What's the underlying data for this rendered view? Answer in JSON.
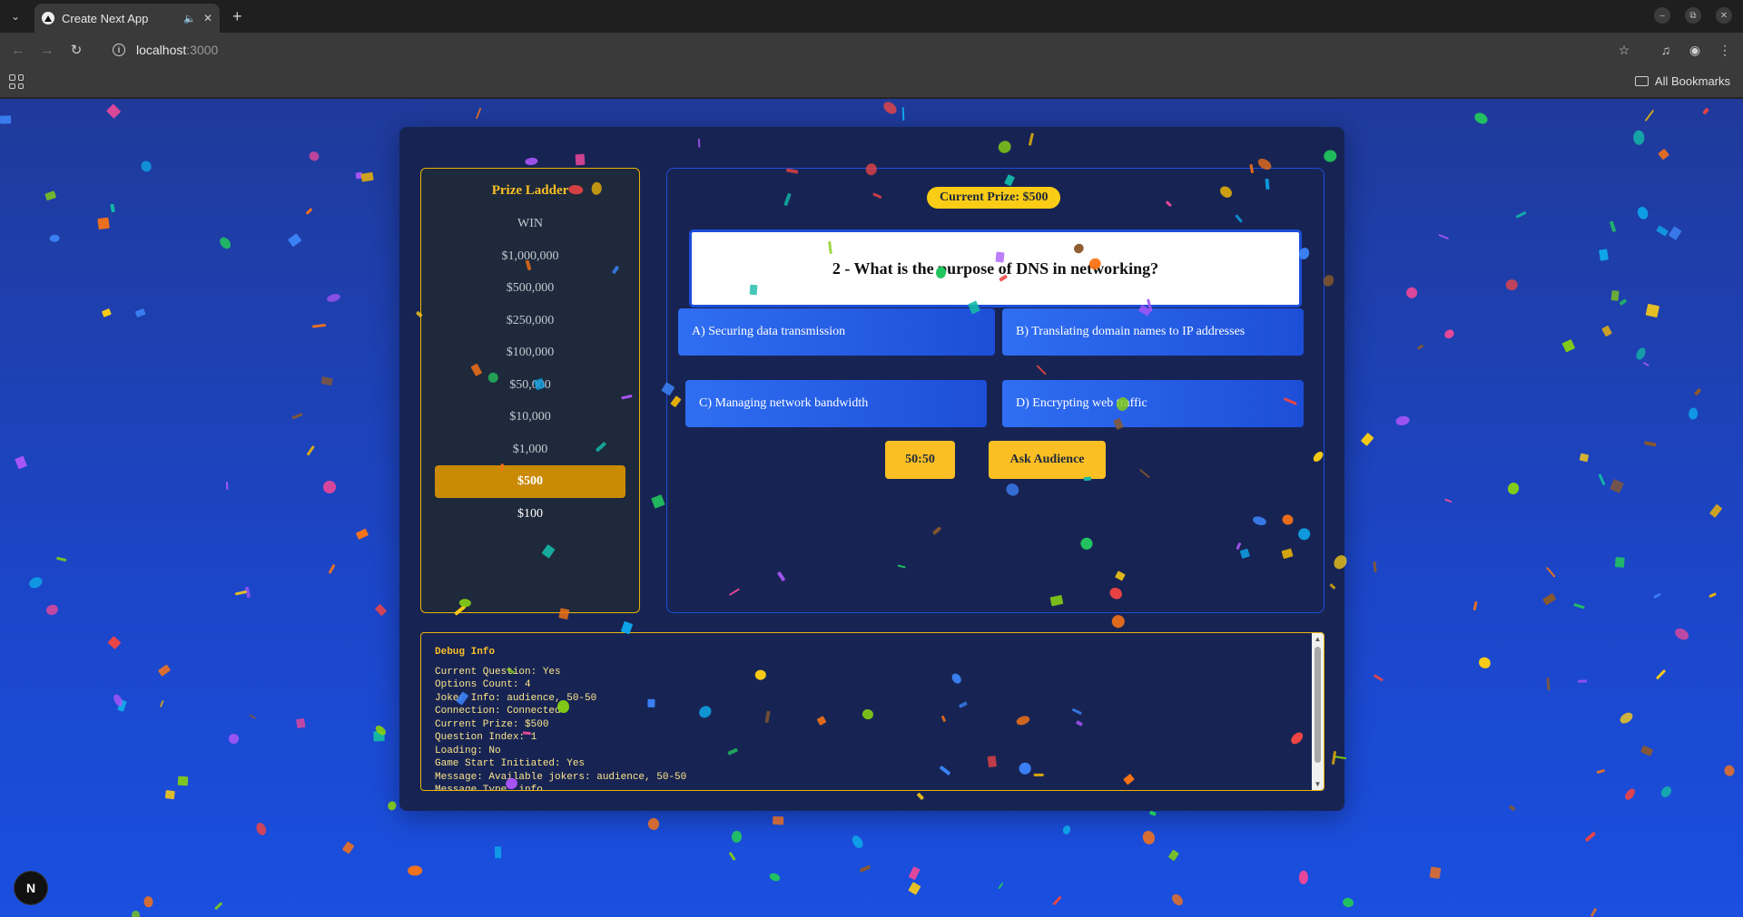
{
  "browser": {
    "tab_title": "Create Next App",
    "url_host": "localhost",
    "url_port": ":3000",
    "bookmarks_label": "All Bookmarks"
  },
  "game": {
    "ladder": {
      "title": "Prize Ladder",
      "items": [
        "WIN",
        "$1,000,000",
        "$500,000",
        "$250,000",
        "$100,000",
        "$50,000",
        "$10,000",
        "$1,000",
        "$500",
        "$100"
      ],
      "active": "$500"
    },
    "current_prize": "Current Prize: $500",
    "question": "2 - What is the purpose of DNS in networking?",
    "options": [
      "A) Securing data transmission",
      "B) Translating domain names to IP addresses",
      "C) Managing network bandwidth",
      "D) Encrypting web traffic"
    ],
    "jokers": {
      "fifty_fifty": "50:50",
      "ask_audience": "Ask Audience"
    }
  },
  "debug": {
    "title": "Debug Info",
    "lines": [
      "Current Question: Yes",
      "Options Count: 4",
      "Joker Info: audience, 50-50",
      "Connection: Connected",
      "Current Prize: $500",
      "Question Index: 1",
      "Loading: No",
      "Game Start Initiated: Yes",
      "Message: Available jokers: audience, 50-50",
      "Message Type: info"
    ]
  },
  "dev_indicator": "N",
  "colors": {
    "page_bg": "#1c46c9",
    "panel_bg": "#172453",
    "accent_gold": "#fbbf24",
    "active_prize": "#ca8a04",
    "option_blue": "#2f6ef2"
  }
}
